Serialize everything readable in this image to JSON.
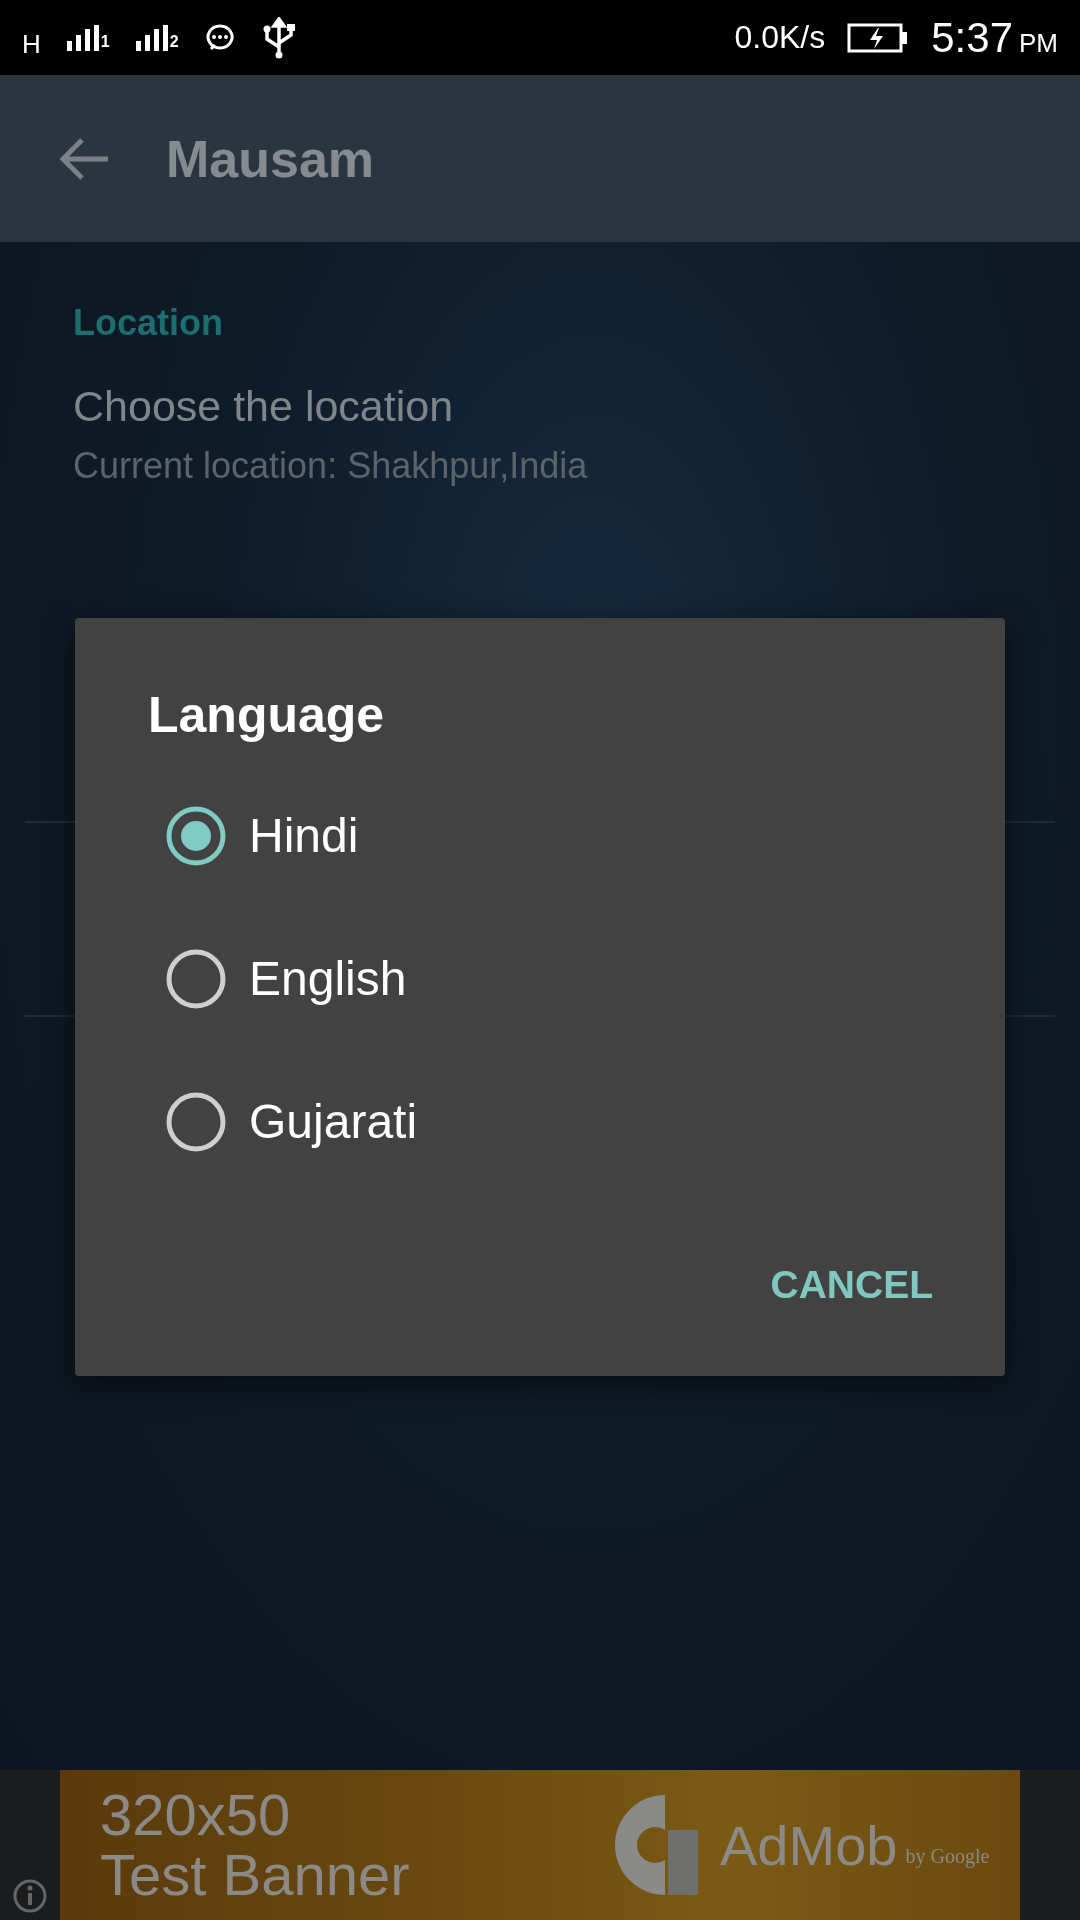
{
  "status_bar": {
    "network": "H",
    "sim_labels": [
      "1",
      "2"
    ],
    "speed": "0.0K/s",
    "time": "5:37",
    "am_pm": "PM"
  },
  "app_bar": {
    "title": "Mausam"
  },
  "settings": {
    "section": "Location",
    "item_title": "Choose the location",
    "item_summary": "Current location: Shakhpur,India"
  },
  "dialog": {
    "title": "Language",
    "options": [
      {
        "label": "Hindi",
        "selected": true
      },
      {
        "label": "English",
        "selected": false
      },
      {
        "label": "Gujarati",
        "selected": false
      }
    ],
    "button": "CANCEL"
  },
  "ad_banner": {
    "size": "320x50",
    "label": "Test Banner",
    "brand": "AdMob",
    "byline": "by Google"
  }
}
